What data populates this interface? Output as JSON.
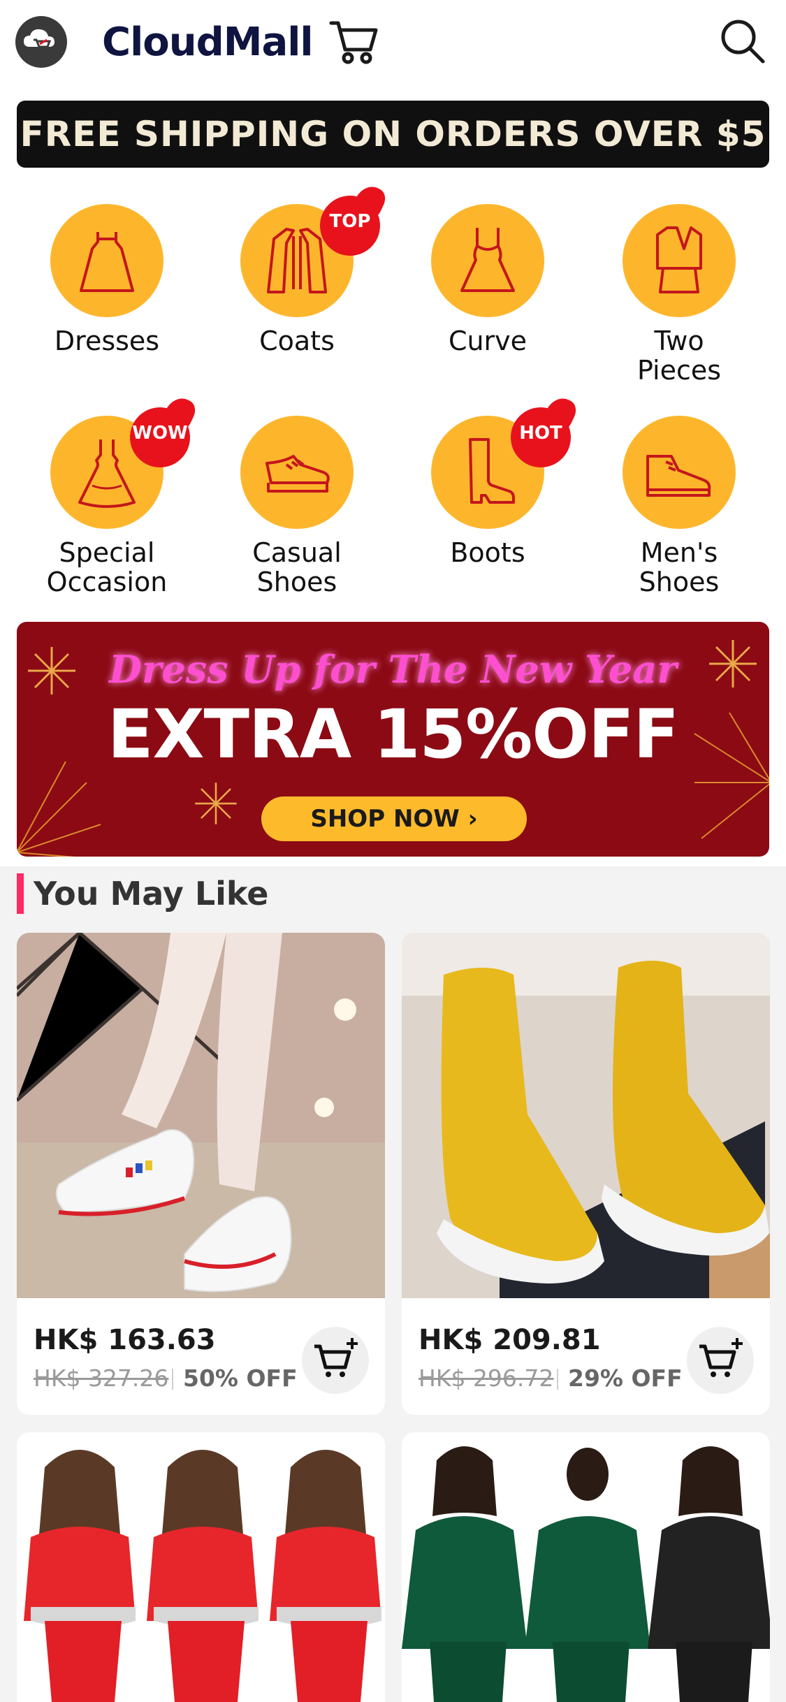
{
  "app": {
    "brand": "CloudMall"
  },
  "header": {
    "cart_icon": "cart-icon",
    "search_icon": "search-icon",
    "logo_icon": "cloud-cart-logo-icon"
  },
  "shipping_bar": {
    "text": "FREE SHIPPING ON ORDERS OVER $5"
  },
  "categories": [
    {
      "label": "Dresses",
      "icon": "dress-icon"
    },
    {
      "label": "Coats",
      "icon": "coat-icon",
      "badge": "TOP"
    },
    {
      "label": "Curve",
      "icon": "curve-dress-icon"
    },
    {
      "label": "Two\nPieces",
      "icon": "two-pieces-icon"
    },
    {
      "label": "Special\nOccasion",
      "icon": "gown-icon",
      "badge": "WOW"
    },
    {
      "label": "Casual\nShoes",
      "icon": "sneaker-icon"
    },
    {
      "label": "Boots",
      "icon": "boot-icon",
      "badge": "HOT"
    },
    {
      "label": "Men's\nShoes",
      "icon": "mens-shoe-icon"
    }
  ],
  "promo": {
    "script_text": "Dress Up for The New Year",
    "headline": "EXTRA 15%OFF",
    "button": "SHOP NOW ›"
  },
  "section": {
    "title": "You May Like"
  },
  "products": [
    {
      "price": "HK$ 163.63",
      "old_price": "HK$ 327.26",
      "discount": "50% OFF"
    },
    {
      "price": "HK$ 209.81",
      "old_price": "HK$ 296.72",
      "discount": "29% OFF"
    },
    {
      "image": "red-gradient-tshirt-set"
    },
    {
      "image": "green-black-suit-set"
    }
  ],
  "colors": {
    "accent_yellow": "#fdb62c",
    "badge_red": "#e8121c",
    "promo_red": "#8c0a14",
    "section_pink": "#ff2a63"
  }
}
